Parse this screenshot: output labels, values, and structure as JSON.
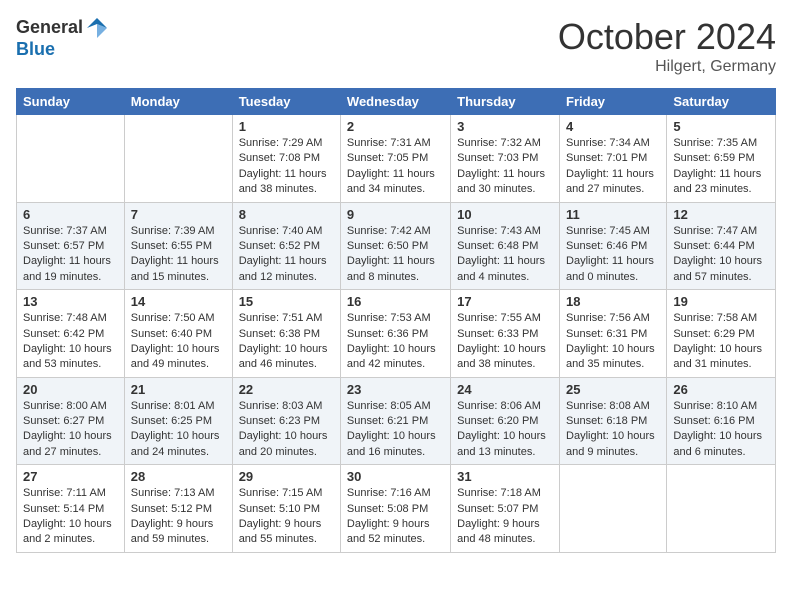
{
  "header": {
    "logo_general": "General",
    "logo_blue": "Blue",
    "month_title": "October 2024",
    "location": "Hilgert, Germany"
  },
  "weekdays": [
    "Sunday",
    "Monday",
    "Tuesday",
    "Wednesday",
    "Thursday",
    "Friday",
    "Saturday"
  ],
  "weeks": [
    [
      {
        "day": "",
        "info": ""
      },
      {
        "day": "",
        "info": ""
      },
      {
        "day": "1",
        "info": "Sunrise: 7:29 AM\nSunset: 7:08 PM\nDaylight: 11 hours and 38 minutes."
      },
      {
        "day": "2",
        "info": "Sunrise: 7:31 AM\nSunset: 7:05 PM\nDaylight: 11 hours and 34 minutes."
      },
      {
        "day": "3",
        "info": "Sunrise: 7:32 AM\nSunset: 7:03 PM\nDaylight: 11 hours and 30 minutes."
      },
      {
        "day": "4",
        "info": "Sunrise: 7:34 AM\nSunset: 7:01 PM\nDaylight: 11 hours and 27 minutes."
      },
      {
        "day": "5",
        "info": "Sunrise: 7:35 AM\nSunset: 6:59 PM\nDaylight: 11 hours and 23 minutes."
      }
    ],
    [
      {
        "day": "6",
        "info": "Sunrise: 7:37 AM\nSunset: 6:57 PM\nDaylight: 11 hours and 19 minutes."
      },
      {
        "day": "7",
        "info": "Sunrise: 7:39 AM\nSunset: 6:55 PM\nDaylight: 11 hours and 15 minutes."
      },
      {
        "day": "8",
        "info": "Sunrise: 7:40 AM\nSunset: 6:52 PM\nDaylight: 11 hours and 12 minutes."
      },
      {
        "day": "9",
        "info": "Sunrise: 7:42 AM\nSunset: 6:50 PM\nDaylight: 11 hours and 8 minutes."
      },
      {
        "day": "10",
        "info": "Sunrise: 7:43 AM\nSunset: 6:48 PM\nDaylight: 11 hours and 4 minutes."
      },
      {
        "day": "11",
        "info": "Sunrise: 7:45 AM\nSunset: 6:46 PM\nDaylight: 11 hours and 0 minutes."
      },
      {
        "day": "12",
        "info": "Sunrise: 7:47 AM\nSunset: 6:44 PM\nDaylight: 10 hours and 57 minutes."
      }
    ],
    [
      {
        "day": "13",
        "info": "Sunrise: 7:48 AM\nSunset: 6:42 PM\nDaylight: 10 hours and 53 minutes."
      },
      {
        "day": "14",
        "info": "Sunrise: 7:50 AM\nSunset: 6:40 PM\nDaylight: 10 hours and 49 minutes."
      },
      {
        "day": "15",
        "info": "Sunrise: 7:51 AM\nSunset: 6:38 PM\nDaylight: 10 hours and 46 minutes."
      },
      {
        "day": "16",
        "info": "Sunrise: 7:53 AM\nSunset: 6:36 PM\nDaylight: 10 hours and 42 minutes."
      },
      {
        "day": "17",
        "info": "Sunrise: 7:55 AM\nSunset: 6:33 PM\nDaylight: 10 hours and 38 minutes."
      },
      {
        "day": "18",
        "info": "Sunrise: 7:56 AM\nSunset: 6:31 PM\nDaylight: 10 hours and 35 minutes."
      },
      {
        "day": "19",
        "info": "Sunrise: 7:58 AM\nSunset: 6:29 PM\nDaylight: 10 hours and 31 minutes."
      }
    ],
    [
      {
        "day": "20",
        "info": "Sunrise: 8:00 AM\nSunset: 6:27 PM\nDaylight: 10 hours and 27 minutes."
      },
      {
        "day": "21",
        "info": "Sunrise: 8:01 AM\nSunset: 6:25 PM\nDaylight: 10 hours and 24 minutes."
      },
      {
        "day": "22",
        "info": "Sunrise: 8:03 AM\nSunset: 6:23 PM\nDaylight: 10 hours and 20 minutes."
      },
      {
        "day": "23",
        "info": "Sunrise: 8:05 AM\nSunset: 6:21 PM\nDaylight: 10 hours and 16 minutes."
      },
      {
        "day": "24",
        "info": "Sunrise: 8:06 AM\nSunset: 6:20 PM\nDaylight: 10 hours and 13 minutes."
      },
      {
        "day": "25",
        "info": "Sunrise: 8:08 AM\nSunset: 6:18 PM\nDaylight: 10 hours and 9 minutes."
      },
      {
        "day": "26",
        "info": "Sunrise: 8:10 AM\nSunset: 6:16 PM\nDaylight: 10 hours and 6 minutes."
      }
    ],
    [
      {
        "day": "27",
        "info": "Sunrise: 7:11 AM\nSunset: 5:14 PM\nDaylight: 10 hours and 2 minutes."
      },
      {
        "day": "28",
        "info": "Sunrise: 7:13 AM\nSunset: 5:12 PM\nDaylight: 9 hours and 59 minutes."
      },
      {
        "day": "29",
        "info": "Sunrise: 7:15 AM\nSunset: 5:10 PM\nDaylight: 9 hours and 55 minutes."
      },
      {
        "day": "30",
        "info": "Sunrise: 7:16 AM\nSunset: 5:08 PM\nDaylight: 9 hours and 52 minutes."
      },
      {
        "day": "31",
        "info": "Sunrise: 7:18 AM\nSunset: 5:07 PM\nDaylight: 9 hours and 48 minutes."
      },
      {
        "day": "",
        "info": ""
      },
      {
        "day": "",
        "info": ""
      }
    ]
  ]
}
